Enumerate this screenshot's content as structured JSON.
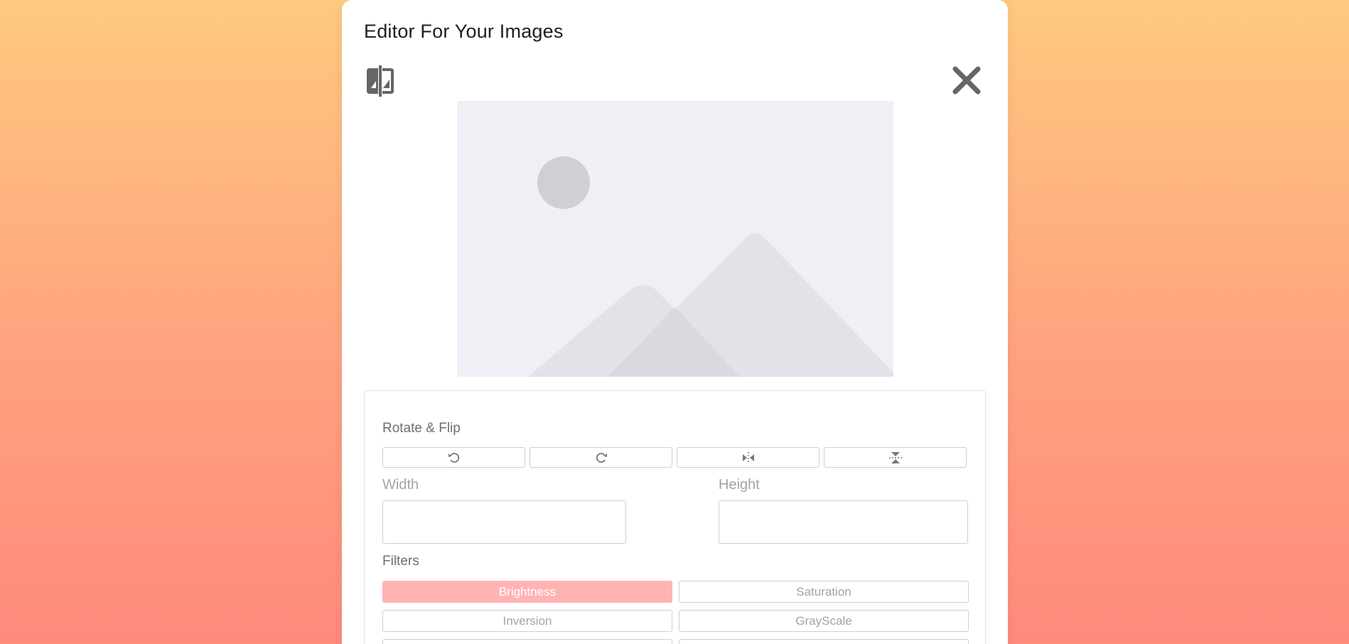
{
  "editor": {
    "title": "Editor For Your Images"
  },
  "rotate_flip": {
    "label": "Rotate & Flip",
    "buttons": [
      {
        "icon": "rotate-left-icon"
      },
      {
        "icon": "rotate-right-icon"
      },
      {
        "icon": "flip-horizontal-icon"
      },
      {
        "icon": "flip-vertical-icon"
      }
    ]
  },
  "size": {
    "width_label": "Width",
    "width_value": "",
    "height_label": "Height",
    "height_value": ""
  },
  "filters": {
    "label": "Filters",
    "items": [
      {
        "label": "Brightness",
        "active": true
      },
      {
        "label": "Saturation",
        "active": false
      },
      {
        "label": "Inversion",
        "active": false
      },
      {
        "label": "GrayScale",
        "active": false
      }
    ]
  },
  "colors": {
    "active_filter": "#ffb4b3",
    "icon": "#666666",
    "placeholder_bg": "#eef0f5"
  }
}
